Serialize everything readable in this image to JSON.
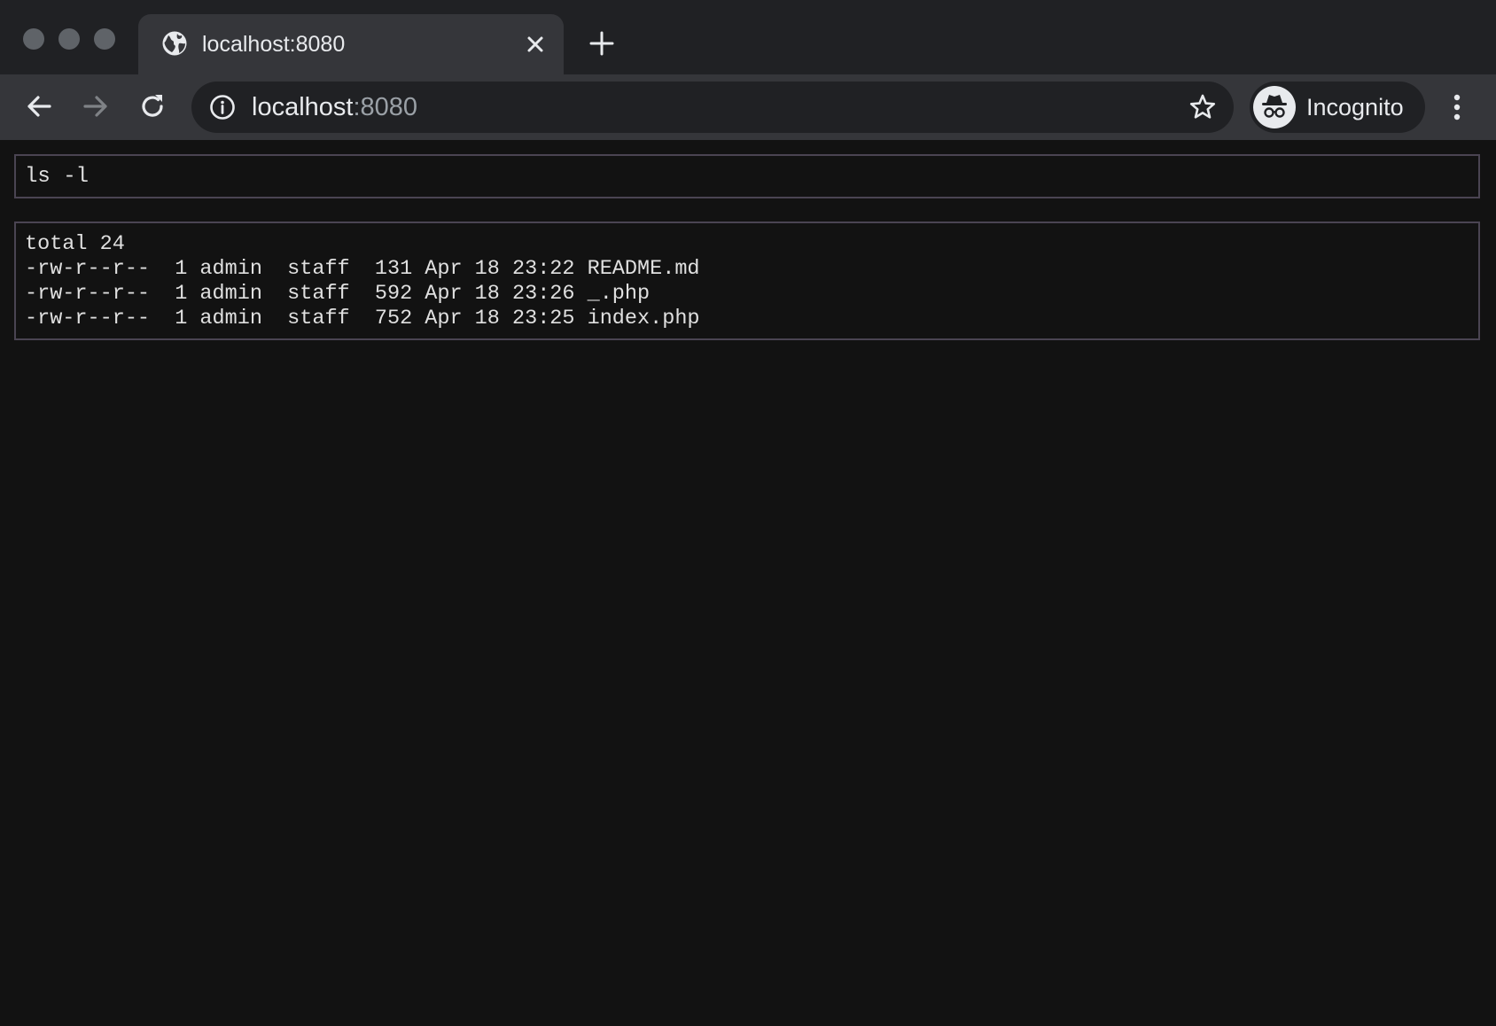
{
  "browser": {
    "tab": {
      "title": "localhost:8080",
      "favicon": "globe-icon"
    },
    "new_tab_icon": "plus-icon",
    "address": {
      "host": "localhost",
      "port": ":8080"
    },
    "profile": {
      "label": "Incognito",
      "icon": "incognito-icon"
    },
    "icons": {
      "back": "arrow-left-icon",
      "forward": "arrow-right-icon",
      "reload": "reload-icon",
      "info": "info-icon",
      "bookmark": "star-icon",
      "menu": "kebab-menu-icon"
    },
    "colors": {
      "tabstrip": "#202124",
      "toolbar": "#35363a",
      "page_background": "#121212",
      "border": "#4a4452"
    }
  },
  "terminal": {
    "command_value": "ls -l",
    "output_lines": [
      "total 24",
      "-rw-r--r--  1 admin  staff  131 Apr 18 23:22 README.md",
      "-rw-r--r--  1 admin  staff  592 Apr 18 23:26 _.php",
      "-rw-r--r--  1 admin  staff  752 Apr 18 23:25 index.php"
    ]
  }
}
